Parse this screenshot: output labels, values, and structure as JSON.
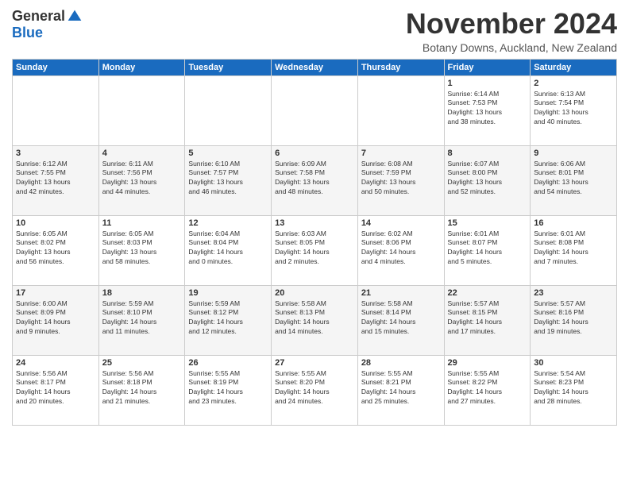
{
  "logo": {
    "general": "General",
    "blue": "Blue"
  },
  "title": "November 2024",
  "subtitle": "Botany Downs, Auckland, New Zealand",
  "days_header": [
    "Sunday",
    "Monday",
    "Tuesday",
    "Wednesday",
    "Thursday",
    "Friday",
    "Saturday"
  ],
  "weeks": [
    [
      {
        "day": "",
        "info": ""
      },
      {
        "day": "",
        "info": ""
      },
      {
        "day": "",
        "info": ""
      },
      {
        "day": "",
        "info": ""
      },
      {
        "day": "",
        "info": ""
      },
      {
        "day": "1",
        "info": "Sunrise: 6:14 AM\nSunset: 7:53 PM\nDaylight: 13 hours\nand 38 minutes."
      },
      {
        "day": "2",
        "info": "Sunrise: 6:13 AM\nSunset: 7:54 PM\nDaylight: 13 hours\nand 40 minutes."
      }
    ],
    [
      {
        "day": "3",
        "info": "Sunrise: 6:12 AM\nSunset: 7:55 PM\nDaylight: 13 hours\nand 42 minutes."
      },
      {
        "day": "4",
        "info": "Sunrise: 6:11 AM\nSunset: 7:56 PM\nDaylight: 13 hours\nand 44 minutes."
      },
      {
        "day": "5",
        "info": "Sunrise: 6:10 AM\nSunset: 7:57 PM\nDaylight: 13 hours\nand 46 minutes."
      },
      {
        "day": "6",
        "info": "Sunrise: 6:09 AM\nSunset: 7:58 PM\nDaylight: 13 hours\nand 48 minutes."
      },
      {
        "day": "7",
        "info": "Sunrise: 6:08 AM\nSunset: 7:59 PM\nDaylight: 13 hours\nand 50 minutes."
      },
      {
        "day": "8",
        "info": "Sunrise: 6:07 AM\nSunset: 8:00 PM\nDaylight: 13 hours\nand 52 minutes."
      },
      {
        "day": "9",
        "info": "Sunrise: 6:06 AM\nSunset: 8:01 PM\nDaylight: 13 hours\nand 54 minutes."
      }
    ],
    [
      {
        "day": "10",
        "info": "Sunrise: 6:05 AM\nSunset: 8:02 PM\nDaylight: 13 hours\nand 56 minutes."
      },
      {
        "day": "11",
        "info": "Sunrise: 6:05 AM\nSunset: 8:03 PM\nDaylight: 13 hours\nand 58 minutes."
      },
      {
        "day": "12",
        "info": "Sunrise: 6:04 AM\nSunset: 8:04 PM\nDaylight: 14 hours\nand 0 minutes."
      },
      {
        "day": "13",
        "info": "Sunrise: 6:03 AM\nSunset: 8:05 PM\nDaylight: 14 hours\nand 2 minutes."
      },
      {
        "day": "14",
        "info": "Sunrise: 6:02 AM\nSunset: 8:06 PM\nDaylight: 14 hours\nand 4 minutes."
      },
      {
        "day": "15",
        "info": "Sunrise: 6:01 AM\nSunset: 8:07 PM\nDaylight: 14 hours\nand 5 minutes."
      },
      {
        "day": "16",
        "info": "Sunrise: 6:01 AM\nSunset: 8:08 PM\nDaylight: 14 hours\nand 7 minutes."
      }
    ],
    [
      {
        "day": "17",
        "info": "Sunrise: 6:00 AM\nSunset: 8:09 PM\nDaylight: 14 hours\nand 9 minutes."
      },
      {
        "day": "18",
        "info": "Sunrise: 5:59 AM\nSunset: 8:10 PM\nDaylight: 14 hours\nand 11 minutes."
      },
      {
        "day": "19",
        "info": "Sunrise: 5:59 AM\nSunset: 8:12 PM\nDaylight: 14 hours\nand 12 minutes."
      },
      {
        "day": "20",
        "info": "Sunrise: 5:58 AM\nSunset: 8:13 PM\nDaylight: 14 hours\nand 14 minutes."
      },
      {
        "day": "21",
        "info": "Sunrise: 5:58 AM\nSunset: 8:14 PM\nDaylight: 14 hours\nand 15 minutes."
      },
      {
        "day": "22",
        "info": "Sunrise: 5:57 AM\nSunset: 8:15 PM\nDaylight: 14 hours\nand 17 minutes."
      },
      {
        "day": "23",
        "info": "Sunrise: 5:57 AM\nSunset: 8:16 PM\nDaylight: 14 hours\nand 19 minutes."
      }
    ],
    [
      {
        "day": "24",
        "info": "Sunrise: 5:56 AM\nSunset: 8:17 PM\nDaylight: 14 hours\nand 20 minutes."
      },
      {
        "day": "25",
        "info": "Sunrise: 5:56 AM\nSunset: 8:18 PM\nDaylight: 14 hours\nand 21 minutes."
      },
      {
        "day": "26",
        "info": "Sunrise: 5:55 AM\nSunset: 8:19 PM\nDaylight: 14 hours\nand 23 minutes."
      },
      {
        "day": "27",
        "info": "Sunrise: 5:55 AM\nSunset: 8:20 PM\nDaylight: 14 hours\nand 24 minutes."
      },
      {
        "day": "28",
        "info": "Sunrise: 5:55 AM\nSunset: 8:21 PM\nDaylight: 14 hours\nand 25 minutes."
      },
      {
        "day": "29",
        "info": "Sunrise: 5:55 AM\nSunset: 8:22 PM\nDaylight: 14 hours\nand 27 minutes."
      },
      {
        "day": "30",
        "info": "Sunrise: 5:54 AM\nSunset: 8:23 PM\nDaylight: 14 hours\nand 28 minutes."
      }
    ]
  ]
}
